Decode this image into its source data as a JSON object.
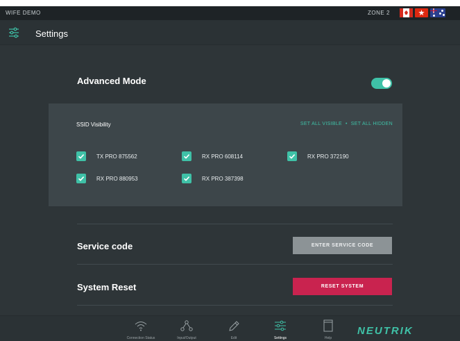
{
  "status_bar": {
    "app_name": "WIFE DEMO",
    "zone": "ZONE 2",
    "flags": [
      "canada-flag",
      "hong-kong-flag",
      "australia-flag"
    ]
  },
  "header": {
    "title": "Settings",
    "icon": "settings-sliders-icon"
  },
  "advanced_mode": {
    "label": "Advanced Mode",
    "enabled": true
  },
  "ssid": {
    "label": "SSID Visibility",
    "set_all_visible": "SET ALL VISIBLE",
    "separator": "•",
    "set_all_hidden": "SET ALL HIDDEN",
    "items": [
      {
        "name": "TX PRO 875562",
        "checked": true
      },
      {
        "name": "RX PRO 608114",
        "checked": true
      },
      {
        "name": "RX PRO 372190",
        "checked": true
      },
      {
        "name": "RX PRO 880953",
        "checked": true
      },
      {
        "name": "RX PRO 387398",
        "checked": true
      }
    ]
  },
  "service_code": {
    "label": "Service code",
    "button": "ENTER SERVICE CODE"
  },
  "system_reset": {
    "label": "System Reset",
    "button": "RESET SYSTEM"
  },
  "bottom_nav": {
    "items": [
      {
        "label": "Connection Status",
        "icon": "wifi-icon"
      },
      {
        "label": "Input/Output",
        "icon": "network-nodes-icon"
      },
      {
        "label": "Edit",
        "icon": "pencil-icon"
      },
      {
        "label": "Settings",
        "icon": "settings-sliders-icon",
        "active": true
      },
      {
        "label": "Help",
        "icon": "document-icon"
      }
    ],
    "logo": "NEUTRIK"
  },
  "colors": {
    "accent": "#3fc1a7",
    "reset": "#c9234f",
    "background": "#2e3538",
    "panel": "#3d464a"
  }
}
